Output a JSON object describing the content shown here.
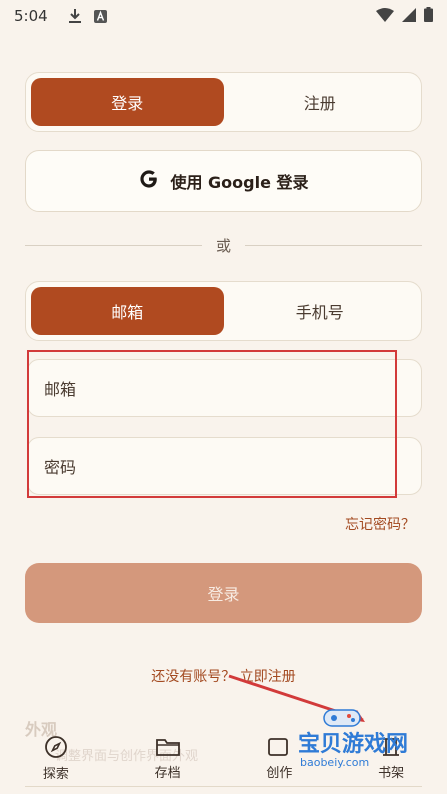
{
  "status_bar": {
    "time": "5:04",
    "icons": [
      "download-icon",
      "a-text-icon",
      "wifi-icon",
      "signal-icon",
      "battery-icon"
    ]
  },
  "auth_tabs": {
    "login": "登录",
    "register": "注册",
    "active": "login"
  },
  "google": {
    "label": "使用 Google 登录",
    "icon": "google-icon"
  },
  "divider": {
    "text": "或"
  },
  "method_tabs": {
    "email": "邮箱",
    "phone": "手机号",
    "active": "email"
  },
  "fields": {
    "email_placeholder": "邮箱",
    "password_placeholder": "密码"
  },
  "forgot_password": "忘记密码？",
  "login_button": "登录",
  "signup_prompt": "还没有账号？ 立即注册",
  "background": {
    "appearance_title": "外观",
    "appearance_sub": "调整界面与创作界面外观"
  },
  "bottom_nav": {
    "items": [
      {
        "label": "探索",
        "icon": "compass-icon"
      },
      {
        "label": "存档",
        "icon": "folder-icon"
      },
      {
        "label": "创作",
        "icon": "create-icon"
      },
      {
        "label": "书架",
        "icon": "shelf-icon"
      }
    ]
  },
  "watermark": {
    "text": "宝贝游戏网",
    "url": "baobeiy.com"
  },
  "colors": {
    "background": "#f9f3ec",
    "accent": "#b04a20",
    "login_disabled": "#d4987c",
    "link": "#a34a21",
    "annotation": "#d23a3a"
  }
}
